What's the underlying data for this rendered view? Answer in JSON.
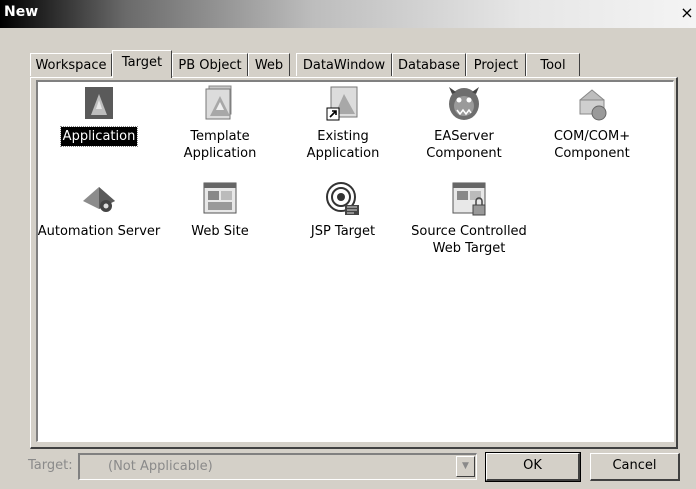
{
  "window": {
    "title": "New",
    "close_glyph": "×"
  },
  "tabs": [
    {
      "label": "Workspace",
      "active": false
    },
    {
      "label": "Target",
      "active": true
    },
    {
      "label": "PB Object",
      "active": false
    },
    {
      "label": "Web",
      "active": false
    },
    {
      "label": "DataWindow",
      "active": false
    },
    {
      "label": "Database",
      "active": false
    },
    {
      "label": "Project",
      "active": false
    },
    {
      "label": "Tool",
      "active": false
    }
  ],
  "items": [
    {
      "label": "Application",
      "icon": "application-icon",
      "selected": true
    },
    {
      "label": "Template\nApplication",
      "icon": "template-application-icon",
      "selected": false
    },
    {
      "label": "Existing Application",
      "icon": "existing-application-icon",
      "selected": false
    },
    {
      "label": "EAServer\nComponent",
      "icon": "easerver-component-icon",
      "selected": false
    },
    {
      "label": "COM/COM+\nComponent",
      "icon": "com-component-icon",
      "selected": false
    },
    {
      "label": "Automation Server",
      "icon": "automation-server-icon",
      "selected": false
    },
    {
      "label": "Web Site",
      "icon": "web-site-icon",
      "selected": false
    },
    {
      "label": "JSP Target",
      "icon": "jsp-target-icon",
      "selected": false
    },
    {
      "label": "Source Controlled\nWeb Target",
      "icon": "source-controlled-web-target-icon",
      "selected": false
    }
  ],
  "footer": {
    "target_label": "Target:",
    "target_value": "(Not Applicable)",
    "ok_label": "OK",
    "cancel_label": "Cancel"
  }
}
